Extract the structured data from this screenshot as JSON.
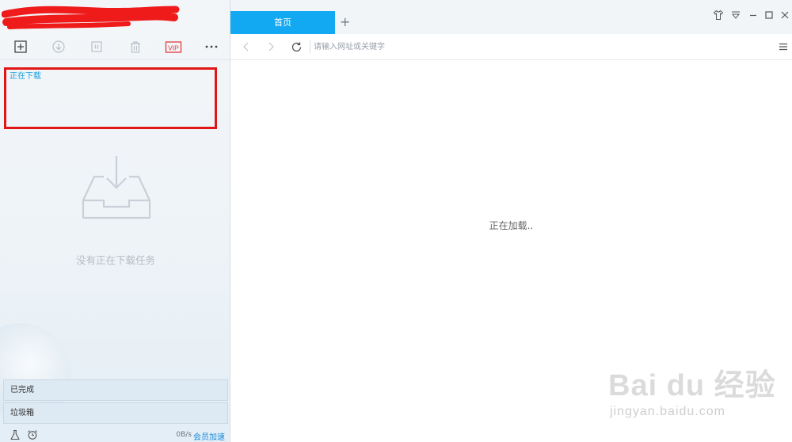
{
  "download_panel": {
    "section_title": "正在下载",
    "empty_message": "没有正在下载任务",
    "toolbar": {
      "new_icon": "plus-square-icon",
      "start_icon": "download-circle-icon",
      "pause_icon": "pause-icon",
      "delete_icon": "trash-icon",
      "vip_label": "VIP",
      "more_icon": "more-icon"
    },
    "categories": [
      {
        "label": "已完成"
      },
      {
        "label": "垃圾箱"
      }
    ],
    "status_bar": {
      "speed": "0B/s",
      "vip_speed_label": "会员加速"
    }
  },
  "browser": {
    "tabs": [
      {
        "label": "首页"
      }
    ],
    "new_tab_label": "+",
    "address_placeholder": "请输入网址或关键字",
    "loading_text": "正在加载.."
  },
  "watermark": {
    "logo": "Bai du 经验",
    "url": "jingyan.baidu.com"
  },
  "colors": {
    "accent": "#12a8f2",
    "highlight_box": "#e01515",
    "link": "#1a8ad8"
  }
}
